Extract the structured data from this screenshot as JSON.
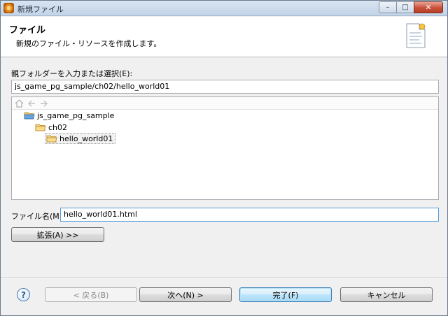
{
  "window": {
    "title": "新規ファイル",
    "minimize_glyph": "–",
    "maximize_glyph": "□",
    "close_glyph": "✕"
  },
  "banner": {
    "title": "ファイル",
    "description": "新規のファイル・リソースを作成します。",
    "icon": "new-file-icon"
  },
  "parent_folder": {
    "label": "親フォルダーを入力または選択(E):",
    "value": "js_game_pg_sample/ch02/hello_world01"
  },
  "tree": {
    "toolbar": [
      "home-icon",
      "back-arrow-icon",
      "forward-arrow-icon"
    ],
    "items": [
      {
        "label": "js_game_pg_sample",
        "icon": "project-folder-icon",
        "level": 0,
        "selected": false
      },
      {
        "label": "ch02",
        "icon": "folder-icon",
        "level": 1,
        "selected": false
      },
      {
        "label": "hello_world01",
        "icon": "folder-icon",
        "level": 2,
        "selected": true
      }
    ]
  },
  "file_name": {
    "label": "ファイル名(M):",
    "value": "hello_world01.html"
  },
  "advanced_button": {
    "label": "拡張(A) >>"
  },
  "footer": {
    "help_glyph": "?",
    "back_label": "< 戻る(B)",
    "next_label": "次へ(N) >",
    "finish_label": "完了(F)",
    "cancel_label": "キャンセル"
  },
  "colors": {
    "accent": "#3c7fb1",
    "folder": "#e8b34a",
    "project_folder": "#4a8bd0"
  }
}
